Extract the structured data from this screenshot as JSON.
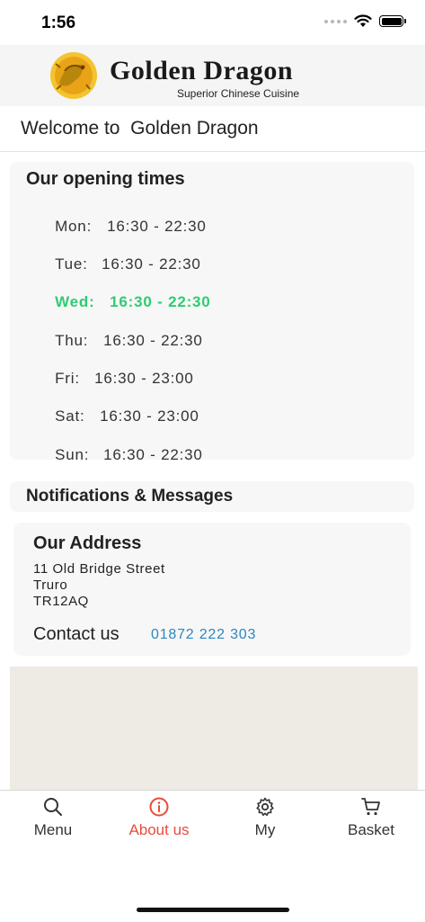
{
  "status_bar": {
    "time": "1:56",
    "icons": [
      "signal-icon",
      "wifi-icon",
      "battery-icon"
    ]
  },
  "header": {
    "brand_title": "Golden Dragon",
    "brand_subtitle": "Superior Chinese Cuisine",
    "logo_icon": "dragon-logo-icon"
  },
  "welcome": {
    "text": "Welcome to  Golden Dragon"
  },
  "opening_times": {
    "title": "Our opening times",
    "rows": [
      {
        "day": "Mon:",
        "hours": "16:30 - 22:30",
        "today": false
      },
      {
        "day": "Tue:",
        "hours": "16:30 - 22:30",
        "today": false
      },
      {
        "day": "Wed:",
        "hours": "16:30 - 22:30",
        "today": true
      },
      {
        "day": "Thu:",
        "hours": "16:30 - 22:30",
        "today": false
      },
      {
        "day": "Fri:",
        "hours": "16:30 - 23:00",
        "today": false
      },
      {
        "day": "Sat:",
        "hours": "16:30 - 23:00",
        "today": false
      },
      {
        "day": "Sun:",
        "hours": "16:30 - 22:30",
        "today": false
      }
    ],
    "today_color": "#2ecc71"
  },
  "notifications": {
    "title": "Notifications & Messages"
  },
  "address": {
    "title": "Our Address",
    "lines": [
      "11 Old Bridge Street",
      "Truro",
      "TR12AQ"
    ],
    "contact_label": "Contact us",
    "phone": "01872 222 303",
    "phone_color": "#2e86c1"
  },
  "tabbar": {
    "tabs": [
      {
        "label": "Menu",
        "icon": "search-icon",
        "active": false
      },
      {
        "label": "About us",
        "icon": "info-icon",
        "active": true
      },
      {
        "label": "My",
        "icon": "gear-icon",
        "active": false
      },
      {
        "label": "Basket",
        "icon": "cart-icon",
        "active": false
      }
    ],
    "active_color": "#e74c3c"
  }
}
